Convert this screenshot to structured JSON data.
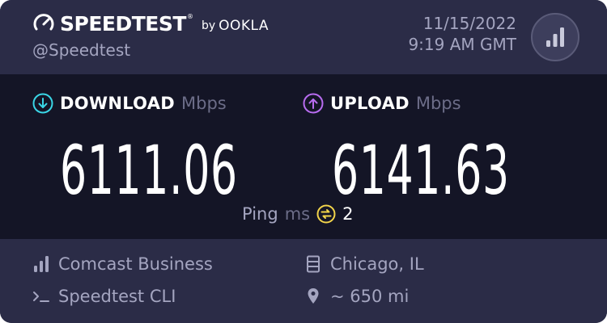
{
  "brand": {
    "name": "SPEEDTEST",
    "trademark": "®",
    "by": "by",
    "company": "OOKLA"
  },
  "user": {
    "handle": "@Speedtest"
  },
  "timestamp": {
    "date": "11/15/2022",
    "time": "9:19 AM GMT"
  },
  "results_button": {
    "icon": "bar-chart-icon"
  },
  "download": {
    "label": "DOWNLOAD",
    "unit": "Mbps",
    "value": "6111.06",
    "icon": "download-arrow-icon",
    "color": "#3ad6e6"
  },
  "upload": {
    "label": "UPLOAD",
    "unit": "Mbps",
    "value": "6141.63",
    "icon": "upload-arrow-icon",
    "color": "#b86cf0"
  },
  "ping": {
    "label": "Ping",
    "unit": "ms",
    "value": "2",
    "icon": "ping-icon",
    "color": "#f2d44a"
  },
  "connection": {
    "isp": {
      "label": "Comcast Business",
      "icon": "signal-bars-icon"
    },
    "client": {
      "label": "Speedtest CLI",
      "icon": "terminal-icon"
    },
    "server": {
      "label": "Chicago, IL",
      "icon": "server-icon"
    },
    "distance": {
      "label": "~ 650 mi",
      "icon": "location-pin-icon"
    }
  },
  "colors": {
    "background": "#2b2c47",
    "panel": "#141526",
    "muted_text": "#a4a5c0",
    "dim_text": "#6c6d88"
  }
}
